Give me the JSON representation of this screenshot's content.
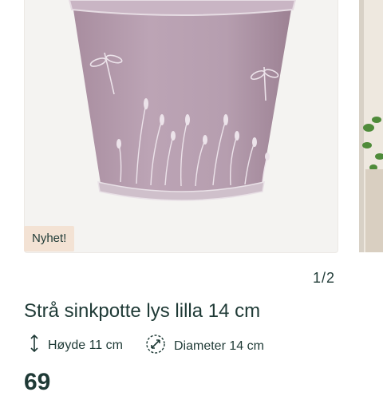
{
  "product": {
    "badge": "Nyhet!",
    "pager": "1/2",
    "title": "Strå sinkpotte lys lilla 14 cm",
    "specs": [
      {
        "icon": "height-arrow-icon",
        "label": "Høyde 11 cm"
      },
      {
        "icon": "diameter-icon",
        "label": "Diameter 14 cm"
      }
    ],
    "price_partial": "69"
  },
  "colors": {
    "text": "#1f3a36",
    "badge_bg": "#f3e2d4",
    "pot": "#b39aac"
  }
}
